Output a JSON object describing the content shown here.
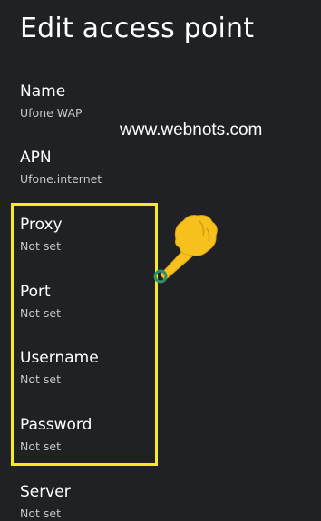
{
  "header": {
    "title": "Edit access point"
  },
  "watermark": "www.webnots.com",
  "preferences": [
    {
      "title": "Name",
      "summary": "Ufone WAP"
    },
    {
      "title": "APN",
      "summary": "Ufone.internet"
    },
    {
      "title": "Proxy",
      "summary": "Not set"
    },
    {
      "title": "Port",
      "summary": "Not set"
    },
    {
      "title": "Username",
      "summary": "Not set"
    },
    {
      "title": "Password",
      "summary": "Not set"
    },
    {
      "title": "Server",
      "summary": "Not set"
    }
  ],
  "colors": {
    "background": "#202124",
    "highlight": "#f5ec1d",
    "pointer_hand": "#f6c11c",
    "pointer_ring": "#2f8f6b"
  },
  "icons": {
    "pointer": "pointing-hand-icon"
  }
}
